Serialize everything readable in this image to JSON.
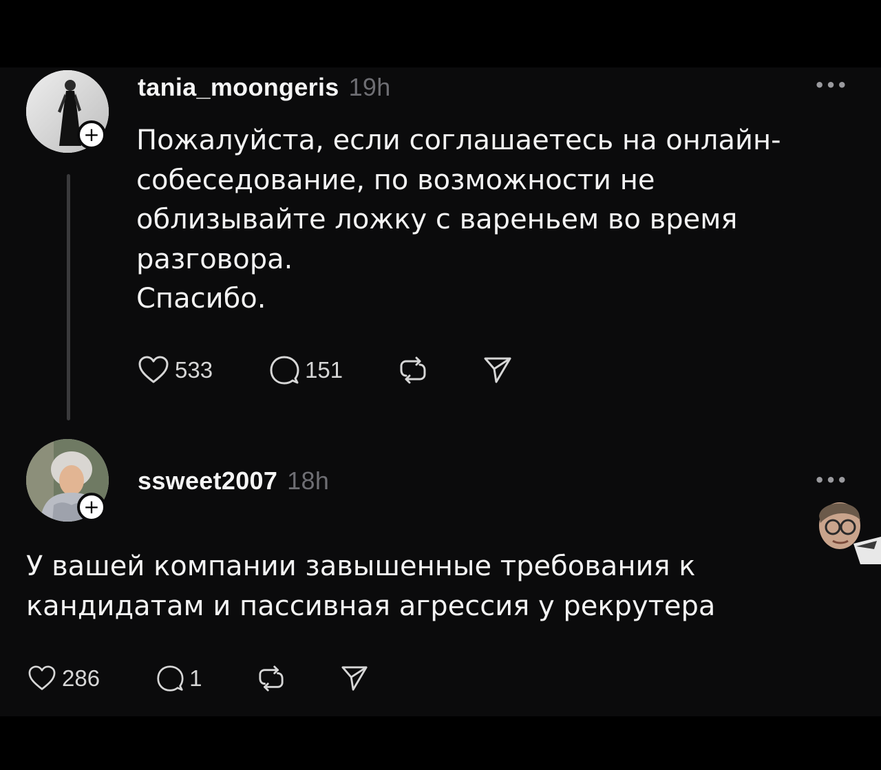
{
  "posts": [
    {
      "username": "tania_moongeris",
      "time": "19h",
      "more": "•••",
      "text_lines": [
        "Пожалуйста, если соглашаетесь на онлайн-",
        "собеседование, по возможности не",
        "облизывайте ложку с вареньем во время",
        "разговора.",
        "Спасибо."
      ],
      "likes": "533",
      "replies": "151",
      "follow_badge": "+"
    },
    {
      "username": "ssweet2007",
      "time": "18h",
      "more": "•••",
      "text_lines": [
        "У вашей компании завышенные требования к",
        "кандидатам и пассивная агрессия у рекрутера"
      ],
      "likes": "286",
      "replies": "1",
      "follow_badge": "+"
    }
  ],
  "icons": {
    "like": "heart-icon",
    "reply": "comment-icon",
    "repost": "repost-icon",
    "share": "send-icon"
  },
  "colors": {
    "background": "#0b0b0c",
    "text": "#f3f3f3",
    "muted": "#6e6e73",
    "thread_line": "#3a3a3c"
  }
}
